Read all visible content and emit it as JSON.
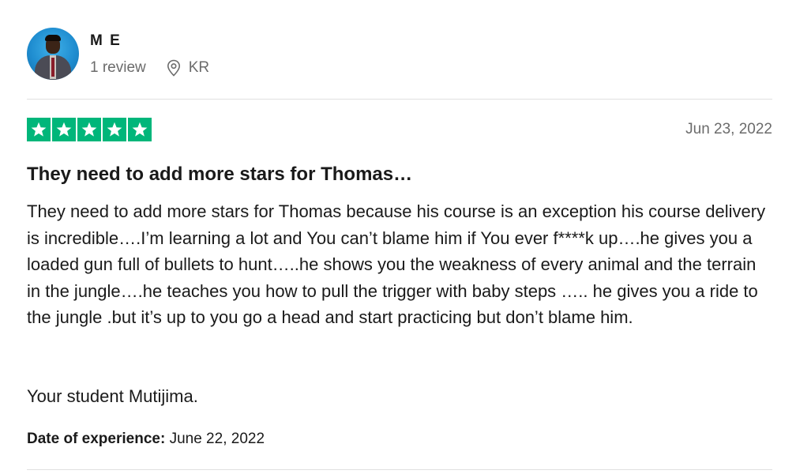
{
  "reviewer": {
    "name": "M E",
    "review_count": "1 review",
    "country": "KR"
  },
  "review": {
    "rating": 5,
    "rating_max": 5,
    "rating_color": "#00b67a",
    "date": "Jun 23, 2022",
    "title": "They need to add more stars for Thomas…",
    "body": "They need to add more stars for Thomas because his course is an exception his course delivery is incredible….I’m learning a lot and You can’t blame him if You ever f****k up….he gives you a loaded gun full of bullets to hunt…..he shows you the weakness of every animal and the terrain in the jungle….he teaches you how to pull the trigger with baby steps ….. he gives you a ride to the jungle .but it’s up to you go a head and start practicing but don’t blame him.",
    "signoff": "Your student Mutijima.",
    "experience_label": "Date of experience:",
    "experience_date": "June 22, 2022"
  },
  "icons": {
    "location": "map-pin-icon",
    "star": "star-icon"
  }
}
